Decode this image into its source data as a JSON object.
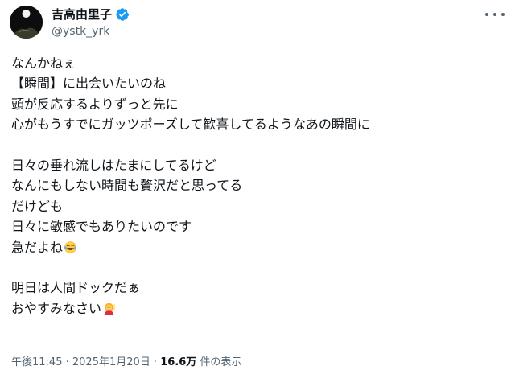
{
  "author": {
    "name": "吉高由里子",
    "handle": "@ystk_yrk",
    "verified_color": "#1d9bf0"
  },
  "tweet": {
    "lines": [
      "なんかねぇ",
      "【瞬間】に出会いたいのね",
      "頭が反応するよりずっと先に",
      "心がもうすでにガッツポーズして歓喜してるようなあの瞬間に",
      "",
      "日々の垂れ流しはたまにしてるけど",
      "なんにもしない時間も贅沢だと思ってる",
      "だけども",
      "日々に敏感でもありたいのです",
      "急だよね",
      "",
      "明日は人間ドックだぁ",
      "おやすみなさい"
    ],
    "emoji": {
      "line_9": "face-with-tears-of-joy-emoji",
      "line_12": "person-raising-hand-emoji"
    }
  },
  "meta": {
    "time": "午後11:45",
    "sep1": " · ",
    "date": "2025年1月20日",
    "sep2": " · ",
    "views_count": "16.6万",
    "views_label": " 件の表示"
  },
  "icons": {
    "more": "more-options-icon",
    "verified": "verified-badge-icon"
  },
  "colors": {
    "text": "#0f1419",
    "secondary": "#536471",
    "accent": "#1d9bf0"
  }
}
